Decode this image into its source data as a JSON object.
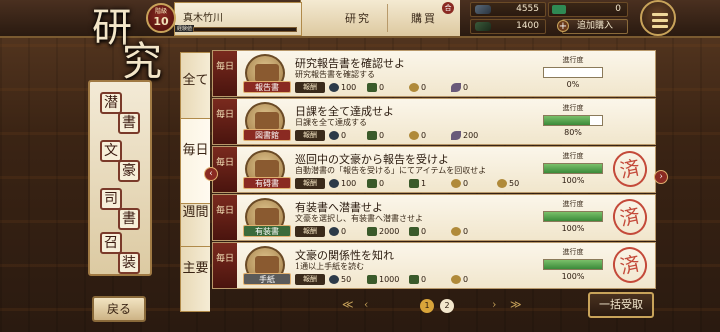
{
  "header": {
    "section_title_1": "研",
    "section_title_2": "究",
    "level_label": "階級",
    "level_value": "10",
    "player_name": "真木竹川",
    "xp_label": "経験値",
    "tab_research": "研究",
    "tab_purchase": "購買",
    "purchase_badge": "合",
    "resource_1": "4555",
    "resource_2": "1400",
    "premium_value": "0",
    "add_purchase_label": "追加購入",
    "add_purchase_plus": "+"
  },
  "sidebar": {
    "items": [
      {
        "a": "潜",
        "b": "書"
      },
      {
        "a": "文",
        "b": "豪"
      },
      {
        "a": "司",
        "b": "書"
      },
      {
        "a": "召",
        "b": "装"
      }
    ],
    "back_label": "戻る"
  },
  "category_tabs": {
    "all": "全て",
    "daily": "毎日",
    "weekly": "週間",
    "main": "主要"
  },
  "missions": [
    {
      "category": "毎日",
      "thumb_label": "報告書",
      "title": "研究報告書を確認せよ",
      "desc": "研究報告書を確認する",
      "reward_label": "報酬",
      "rewards": [
        "100",
        "0",
        "0",
        "0"
      ],
      "progress_label": "進行度",
      "progress_value": "0%",
      "progress_fraction": 0,
      "completed": false
    },
    {
      "category": "毎日",
      "thumb_label": "図書館",
      "title": "日課を全て達成せよ",
      "desc": "日課を全て達成する",
      "reward_label": "報酬",
      "rewards": [
        "0",
        "0",
        "0",
        "200"
      ],
      "progress_label": "進行度",
      "progress_value": "80%",
      "progress_fraction": 0.8,
      "completed": false
    },
    {
      "category": "毎日",
      "thumb_label": "有碍書",
      "title": "巡回中の文豪から報告を受けよ",
      "desc": "自動潜書の「報告を受ける」にてアイテムを回収せよ",
      "reward_label": "報酬",
      "rewards": [
        "100",
        "0",
        "1",
        "0",
        "50"
      ],
      "progress_label": "進行度",
      "progress_value": "100%",
      "progress_fraction": 1,
      "completed": true,
      "stamp": "済"
    },
    {
      "category": "毎日",
      "thumb_label": "有装書",
      "title": "有装書へ潜書せよ",
      "desc": "文豪を選択し、有装書へ潜書させよ",
      "reward_label": "報酬",
      "rewards": [
        "0",
        "2000",
        "0",
        "0"
      ],
      "progress_label": "進行度",
      "progress_value": "100%",
      "progress_fraction": 1,
      "completed": true,
      "stamp": "済"
    },
    {
      "category": "毎日",
      "thumb_label": "手紙",
      "title": "文豪の関係性を知れ",
      "desc": "1通以上手紙を読む",
      "reward_label": "報酬",
      "rewards": [
        "50",
        "1000",
        "0",
        "0"
      ],
      "progress_label": "進行度",
      "progress_value": "100%",
      "progress_fraction": 1,
      "completed": true,
      "stamp": "済"
    }
  ],
  "pager": {
    "first": "≪",
    "prev": "‹",
    "next": "›",
    "last": "≫",
    "page1": "1",
    "page2": "2"
  },
  "claim_all_label": "一括受取",
  "colors": {
    "accent_red": "#8a2a22",
    "gold": "#c8a35a",
    "progress_green": "#3a8a3a",
    "stamp_red": "#c44a3a"
  },
  "icons": {
    "reward_1": "ink-bottle-icon",
    "reward_2": "book-icon",
    "reward_3": "coin-icon",
    "reward_4": "quill-icon"
  }
}
